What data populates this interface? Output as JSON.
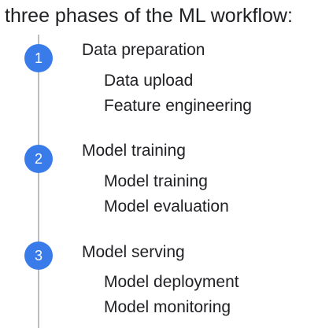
{
  "title": "three phases of the ML workflow:",
  "colors": {
    "badge": "#3a7bea",
    "line": "#bdbdbd",
    "text": "#202124"
  },
  "phases": [
    {
      "number": "1",
      "title": "Data preparation",
      "steps": [
        "Data upload",
        "Feature engineering"
      ]
    },
    {
      "number": "2",
      "title": "Model training",
      "steps": [
        "Model training",
        "Model evaluation"
      ]
    },
    {
      "number": "3",
      "title": "Model serving",
      "steps": [
        "Model deployment",
        "Model monitoring"
      ]
    }
  ]
}
